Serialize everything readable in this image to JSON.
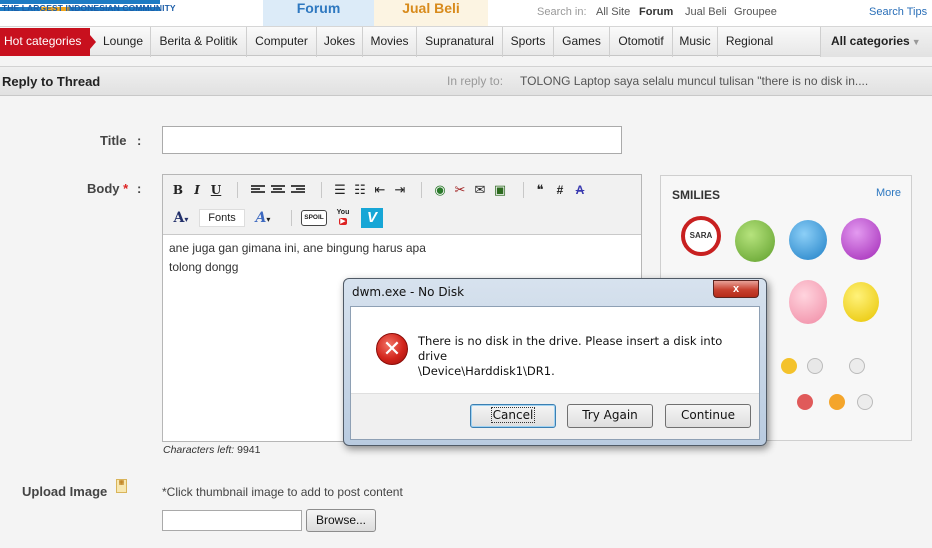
{
  "header": {
    "tagline": "THE LARGEST INDONESIAN COMMUNITY",
    "tabs": {
      "forum": "Forum",
      "jual_beli": "Jual Beli"
    },
    "search_in_label": "Search in:",
    "search_options": [
      "All Site",
      "Forum",
      "Jual Beli",
      "Groupee"
    ],
    "search_tips": "Search Tips"
  },
  "nav": {
    "hot_label": "Hot categories",
    "categories": [
      "Lounge",
      "Berita & Politik",
      "Computer",
      "Jokes",
      "Movies",
      "Supranatural",
      "Sports",
      "Games",
      "Otomotif",
      "Music",
      "Regional"
    ],
    "all_categories": "All categories"
  },
  "reply": {
    "title": "Reply to Thread",
    "in_reply_label": "In reply to:",
    "in_reply_text": "TOLONG Laptop saya selalu muncul tulisan \"there is no disk in...."
  },
  "form": {
    "title_label": "Title",
    "body_label": "Body",
    "required_mark": "*",
    "colon": ":",
    "title_value": "",
    "body_lines": [
      "ane juga gan gimana ini, ane bingung harus apa",
      "tolong dongg"
    ],
    "chars_left_label": "Characters left:",
    "chars_left_value": "9941",
    "fonts_label": "Fonts",
    "spoil_label": "SPOIL",
    "youtube_label": "You",
    "vimeo_label": "V"
  },
  "smilies": {
    "title": "SMILIES",
    "more": "More",
    "first_badge_text": "SARA"
  },
  "upload": {
    "label": "Upload Image",
    "hint": "*Click thumbnail image to add to post content",
    "browse": "Browse..."
  },
  "dialog": {
    "title": "dwm.exe - No Disk",
    "close": "x",
    "message_line1": "There is no disk in the drive. Please insert a disk into drive",
    "message_line2": "\\Device\\Harddisk1\\DR1.",
    "buttons": {
      "cancel": "Cancel",
      "try_again": "Try Again",
      "continue": "Continue"
    }
  },
  "colors": {
    "hot_red": "#c8101e",
    "forum_blue": "#2e78c0",
    "jualbeli_orange": "#d88b1c"
  }
}
